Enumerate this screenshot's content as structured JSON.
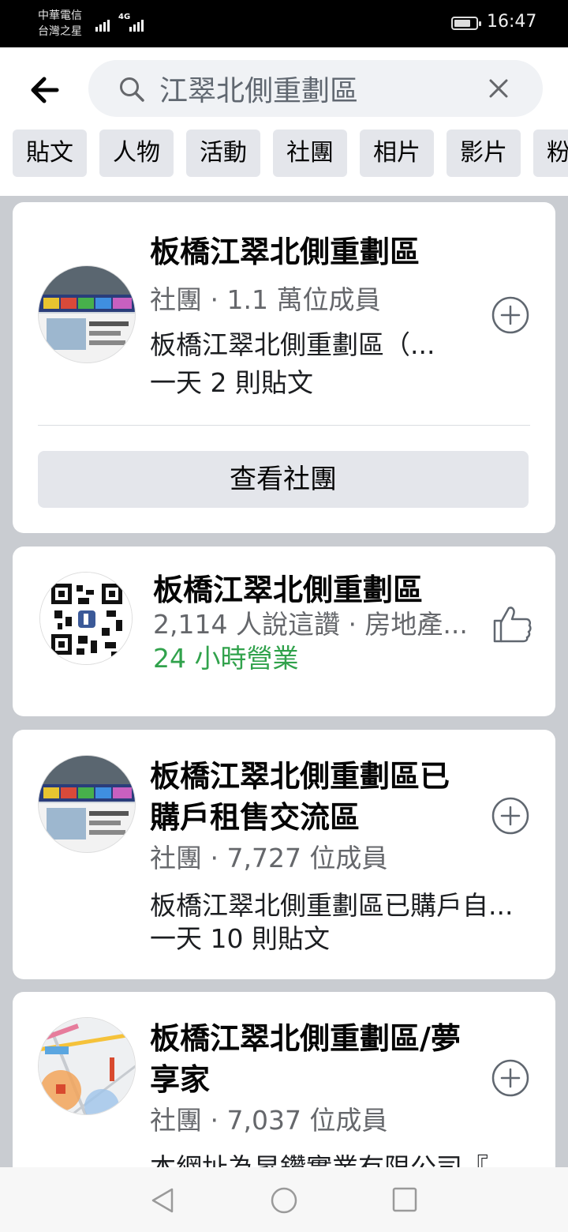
{
  "status_bar": {
    "carrier_line1": "中華電信",
    "carrier_line2": "台灣之星",
    "network": "4G",
    "time": "16:47",
    "battery_level": 0.75
  },
  "search": {
    "query": "江翠北側重劃區",
    "icons": {
      "back": "arrow-left-icon",
      "search": "search-icon",
      "clear": "close-icon"
    }
  },
  "filters": [
    "貼文",
    "人物",
    "活動",
    "社團",
    "相片",
    "影片",
    "粉"
  ],
  "results": [
    {
      "name": "板橋江翠北側重劃區",
      "meta": "社團 · 1.1 萬位成員",
      "description": "板橋江翠北側重劃區（...",
      "activity": "一天 2 則貼文",
      "action_icon": "add-circle-icon",
      "view_button": "查看社團"
    },
    {
      "name": "板橋江翠北側重劃區",
      "meta": "2,114 人說這讚 · 房地產...",
      "hours": "24 小時營業",
      "action_icon": "like-icon"
    },
    {
      "name_line1": "板橋江翠北側重劃區已",
      "name_line2": "購戶租售交流區",
      "meta": "社團 · 7,727 位成員",
      "description": "板橋江翠北側重劃區已購戶自...",
      "activity": "一天 10 則貼文",
      "action_icon": "add-circle-icon"
    },
    {
      "name_line1": "板橋江翠北側重劃區/夢",
      "name_line2": "享家",
      "meta": "社團 · 7,037 位成員",
      "description": "本網址為昇鑽實業有限公司『",
      "action_icon": "add-circle-icon"
    }
  ],
  "nav": {
    "back": "triangle-back-icon",
    "home": "circle-home-icon",
    "recents": "square-recents-icon"
  },
  "colors": {
    "accent_green": "#31a24c",
    "chip_bg": "#e4e6eb",
    "page_bg": "#c9ccd1"
  }
}
